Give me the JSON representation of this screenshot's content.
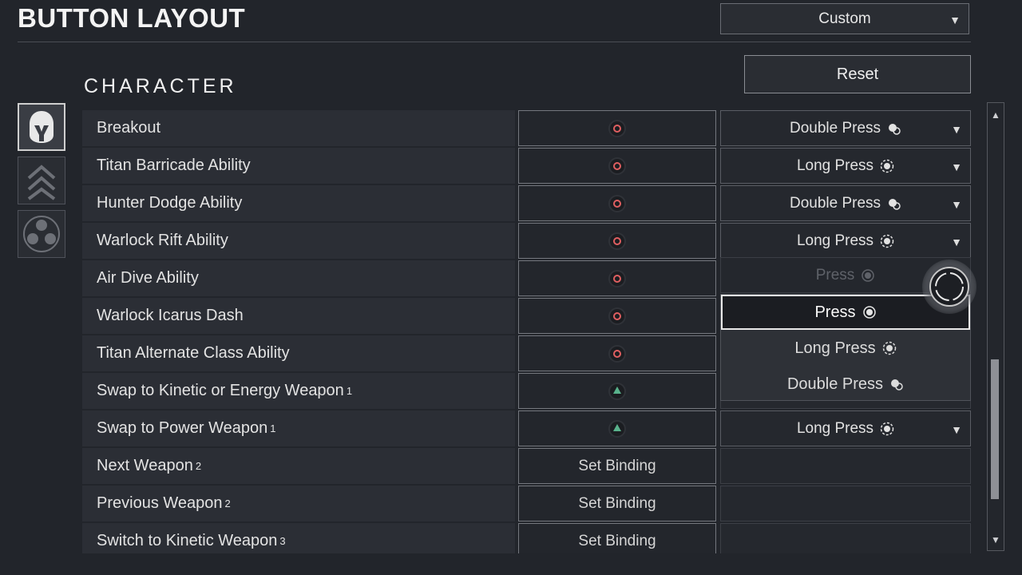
{
  "header": {
    "title": "BUTTON LAYOUT",
    "preset": "Custom",
    "reset_label": "Reset"
  },
  "section": {
    "label": "CHARACTER"
  },
  "categories": [
    {
      "name": "helmet-icon",
      "active": true
    },
    {
      "name": "chevrons-icon",
      "active": false
    },
    {
      "name": "ability-circles-icon",
      "active": false
    }
  ],
  "rows": [
    {
      "label": "Breakout",
      "sup": "",
      "binding": "circle",
      "binding_text": "",
      "press": "Double Press",
      "press_icon": "double-press-icon"
    },
    {
      "label": "Titan Barricade Ability",
      "sup": "",
      "binding": "circle",
      "binding_text": "",
      "press": "Long Press",
      "press_icon": "long-press-icon"
    },
    {
      "label": "Hunter Dodge Ability",
      "sup": "",
      "binding": "circle",
      "binding_text": "",
      "press": "Double Press",
      "press_icon": "double-press-icon"
    },
    {
      "label": "Warlock Rift Ability",
      "sup": "",
      "binding": "circle",
      "binding_text": "",
      "press": "Long Press",
      "press_icon": "long-press-icon"
    },
    {
      "label": "Air Dive Ability",
      "sup": "",
      "binding": "circle",
      "binding_text": "",
      "press": "Press",
      "press_icon": "press-icon"
    },
    {
      "label": "Warlock Icarus Dash",
      "sup": "",
      "binding": "circle",
      "binding_text": "",
      "press": "",
      "press_icon": ""
    },
    {
      "label": "Titan Alternate Class Ability",
      "sup": "",
      "binding": "circle",
      "binding_text": "",
      "press": "",
      "press_icon": ""
    },
    {
      "label": "Swap to Kinetic or Energy Weapon",
      "sup": "1",
      "binding": "triangle",
      "binding_text": "",
      "press": "",
      "press_icon": ""
    },
    {
      "label": "Swap to Power Weapon",
      "sup": "1",
      "binding": "triangle",
      "binding_text": "",
      "press": "Long Press",
      "press_icon": "long-press-icon"
    },
    {
      "label": "Next Weapon",
      "sup": "2",
      "binding": "text",
      "binding_text": "Set Binding",
      "press": "",
      "press_icon": ""
    },
    {
      "label": "Previous Weapon",
      "sup": "2",
      "binding": "text",
      "binding_text": "Set Binding",
      "press": "",
      "press_icon": ""
    },
    {
      "label": "Switch to Kinetic Weapon",
      "sup": "3",
      "binding": "text",
      "binding_text": "Set Binding",
      "press": "",
      "press_icon": ""
    }
  ],
  "dropdown": {
    "current": "Press",
    "options": [
      "Press",
      "Long Press",
      "Double Press"
    ],
    "selected_index": 0
  },
  "colors": {
    "circle": "#e05f61",
    "triangle": "#59b28c",
    "background": "#22252b"
  }
}
